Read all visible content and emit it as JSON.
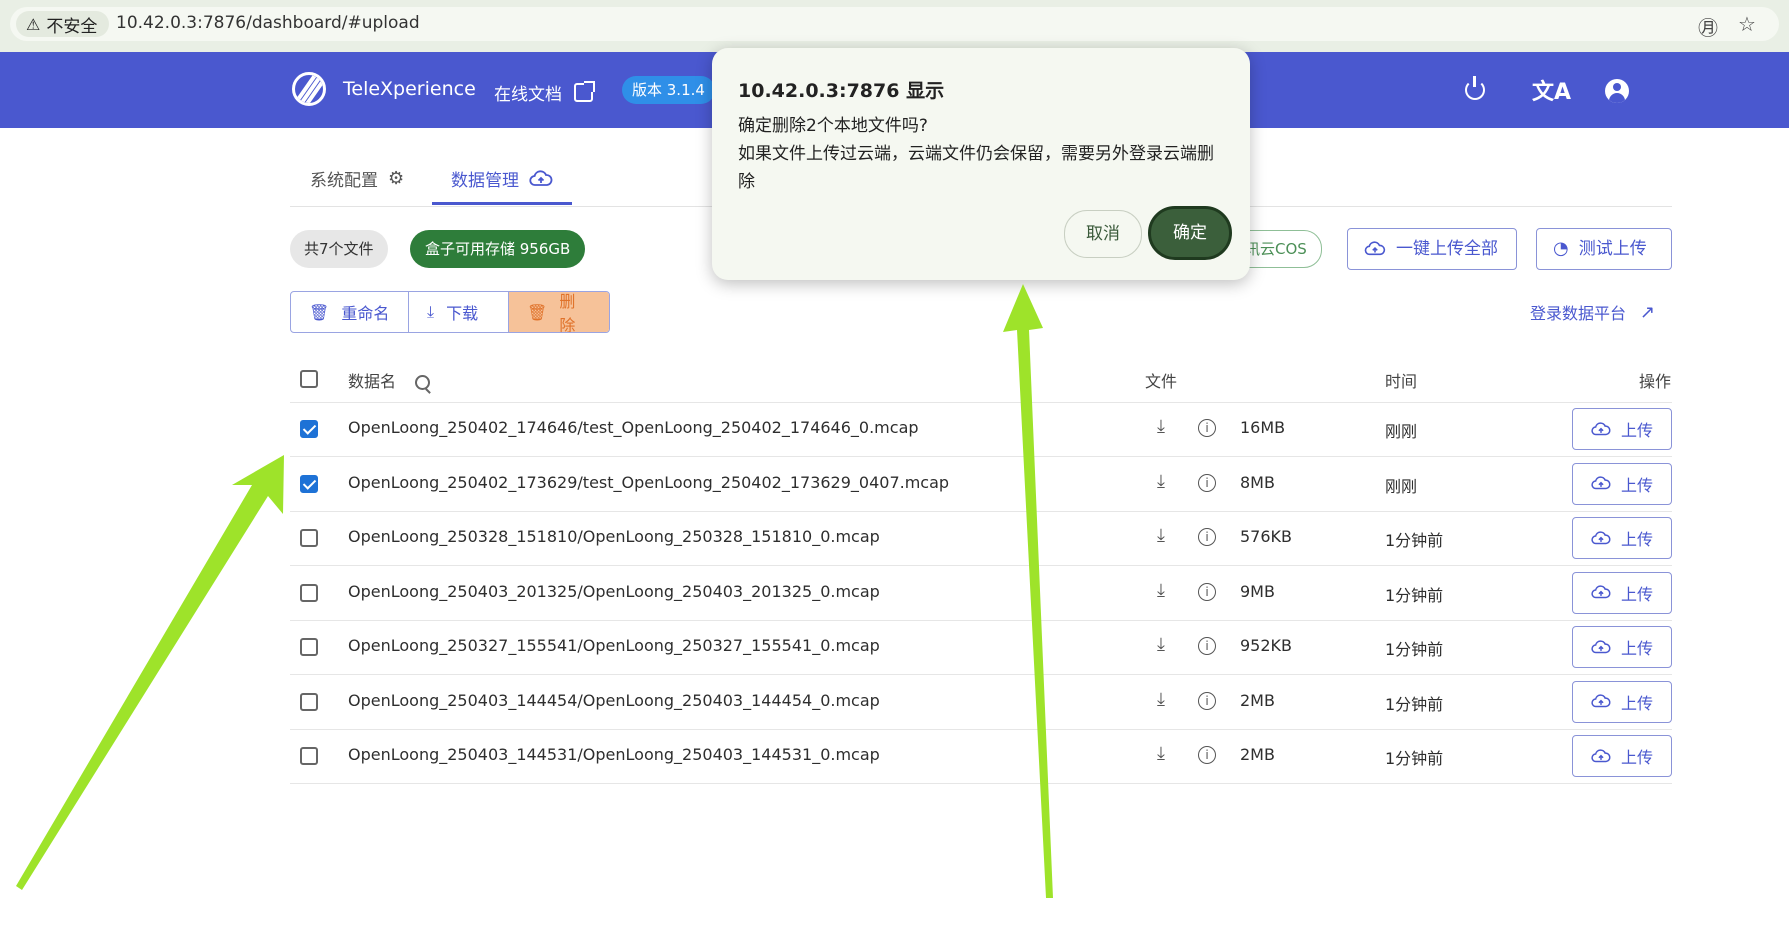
{
  "browser": {
    "security_label": "不安全",
    "url": "10.42.0.3:7876/dashboard/#upload",
    "icons": [
      "warning-icon",
      "translate-icon",
      "star-icon"
    ]
  },
  "nav": {
    "brand": "TeleXperience",
    "docs_label": "在线文档",
    "version": "版本 3.1.4",
    "icons": [
      "logo-icon",
      "external-link-icon",
      "power-icon",
      "translate-icon",
      "account-icon"
    ],
    "color": "#4a58cf"
  },
  "tabs": [
    {
      "label": "系统配置",
      "icon": "gear-icon"
    },
    {
      "label": "数据管理",
      "icon": "cloud-upload-icon",
      "active": true
    }
  ],
  "summary": {
    "total_files": "共7个文件",
    "storage": "盒子可用存储 956GB",
    "cos": "讯云COS"
  },
  "buttons": {
    "upload_all": "一键上传全部",
    "test_upload": "测试上传",
    "rename": "重命名",
    "download": "下载",
    "delete": "删除",
    "platform_login": "登录数据平台"
  },
  "table": {
    "headers": {
      "name": "数据名",
      "file": "文件",
      "time": "时间",
      "action": "操作"
    },
    "upload_label": "上传",
    "rows": [
      {
        "name": "OpenLoong_250402_174646/test_OpenLoong_250402_174646_0.mcap",
        "size": "16MB",
        "time": "刚刚",
        "checked": true
      },
      {
        "name": "OpenLoong_250402_173629/test_OpenLoong_250402_173629_0407.mcap",
        "size": "8MB",
        "time": "刚刚",
        "checked": true
      },
      {
        "name": "OpenLoong_250328_151810/OpenLoong_250328_151810_0.mcap",
        "size": "576KB",
        "time": "1分钟前",
        "checked": false
      },
      {
        "name": "OpenLoong_250403_201325/OpenLoong_250403_201325_0.mcap",
        "size": "9MB",
        "time": "1分钟前",
        "checked": false
      },
      {
        "name": "OpenLoong_250327_155541/OpenLoong_250327_155541_0.mcap",
        "size": "952KB",
        "time": "1分钟前",
        "checked": false
      },
      {
        "name": "OpenLoong_250403_144454/OpenLoong_250403_144454_0.mcap",
        "size": "2MB",
        "time": "1分钟前",
        "checked": false
      },
      {
        "name": "OpenLoong_250403_144531/OpenLoong_250403_144531_0.mcap",
        "size": "2MB",
        "time": "1分钟前",
        "checked": false
      }
    ]
  },
  "dialog": {
    "title": "10.42.0.3:7876 显示",
    "line1": "确定删除2个本地文件吗?",
    "line2": "如果文件上传过云端，云端文件仍会保留，需要另外登录云端删除",
    "cancel": "取消",
    "ok": "确定"
  },
  "annotation_color": "#9ee32a"
}
